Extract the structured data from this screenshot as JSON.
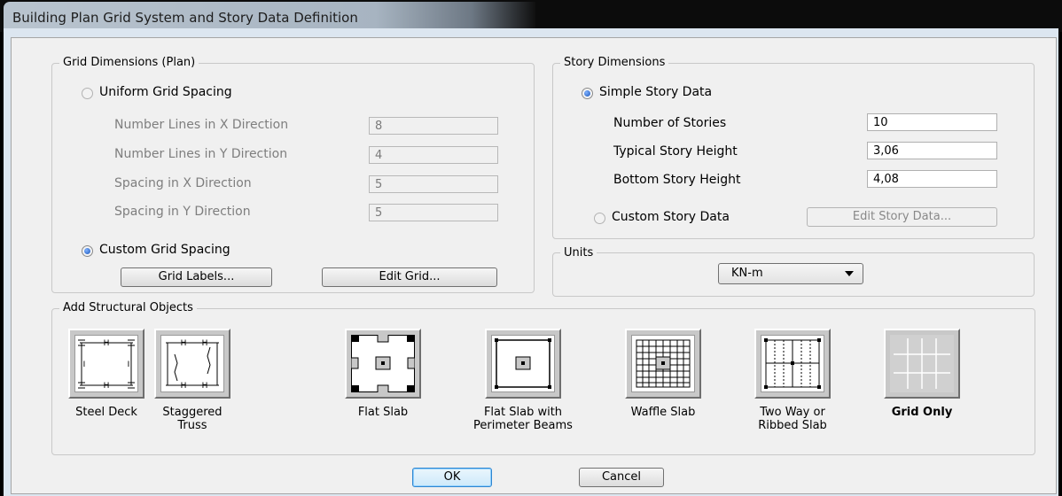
{
  "window": {
    "title": "Building Plan Grid System and Story Data Definition"
  },
  "grid_dimensions": {
    "title": "Grid Dimensions (Plan)",
    "uniform_option": "Uniform Grid Spacing",
    "uniform_selected": false,
    "fields": [
      {
        "label": "Number Lines in X Direction",
        "value": "8"
      },
      {
        "label": "Number Lines in Y Direction",
        "value": "4"
      },
      {
        "label": "Spacing in X Direction",
        "value": "5"
      },
      {
        "label": "Spacing in Y Direction",
        "value": "5"
      }
    ],
    "custom_option": "Custom Grid Spacing",
    "custom_selected": true,
    "grid_labels_button": "Grid Labels...",
    "edit_grid_button": "Edit Grid..."
  },
  "story_dimensions": {
    "title": "Story Dimensions",
    "simple_option": "Simple Story Data",
    "simple_selected": true,
    "fields": [
      {
        "label": "Number of Stories",
        "value": "10"
      },
      {
        "label": "Typical Story Height",
        "value": "3,06"
      },
      {
        "label": "Bottom Story Height",
        "value": "4,08"
      }
    ],
    "custom_option": "Custom Story Data",
    "custom_selected": false,
    "edit_story_button": "Edit Story Data..."
  },
  "units": {
    "title": "Units",
    "selected": "KN-m"
  },
  "structural_objects": {
    "title": "Add Structural Objects",
    "items": [
      {
        "line1": "Steel Deck",
        "line2": "",
        "icon": "steel-deck-icon"
      },
      {
        "line1": "Staggered",
        "line2": "Truss",
        "icon": "staggered-truss-icon"
      },
      {
        "line1": "Flat Slab",
        "line2": "",
        "icon": "flat-slab-icon"
      },
      {
        "line1": "Flat Slab with",
        "line2": "Perimeter Beams",
        "icon": "flat-slab-perimeter-beams-icon"
      },
      {
        "line1": "Waffle Slab",
        "line2": "",
        "icon": "waffle-slab-icon"
      },
      {
        "line1": "Two Way or",
        "line2": "Ribbed Slab",
        "icon": "two-way-ribbed-slab-icon"
      },
      {
        "line1": "Grid Only",
        "line2": "",
        "icon": "grid-only-icon",
        "selected": true
      }
    ]
  },
  "footer": {
    "ok_button": "OK",
    "cancel_button": "Cancel"
  },
  "colors": {
    "dialog_bg": "#f0f0f0",
    "tile_bg": "#c8c8c8",
    "selected_radio": "#1b55b8",
    "default_button_border": "#2f86d0"
  }
}
